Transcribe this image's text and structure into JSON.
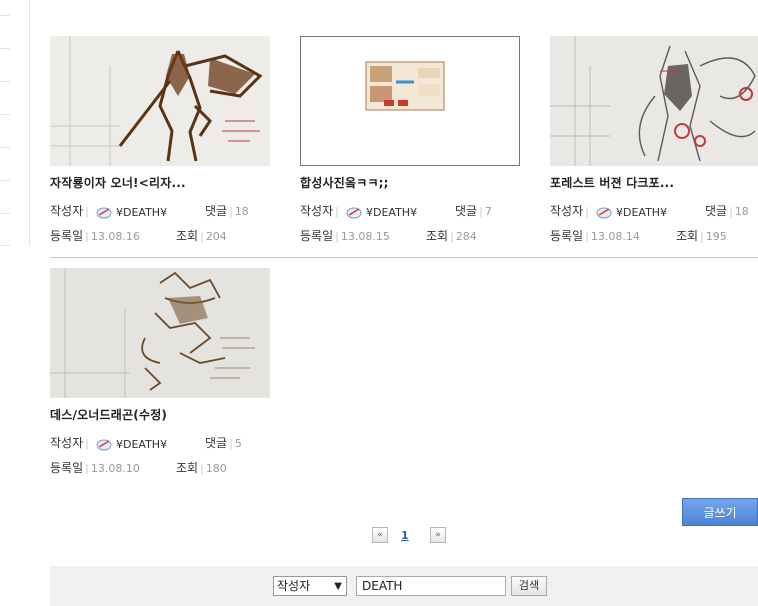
{
  "posts": [
    {
      "title": "자작룡이자 오너!<리자...",
      "author_label": "작성자",
      "author": "¥DEATH¥",
      "comments_label": "댓글",
      "comments": "18",
      "date_label": "등록일",
      "date": "13.08.16",
      "views_label": "조회",
      "views": "204"
    },
    {
      "title": "합성사진옼ㅋㅋ;;",
      "author_label": "작성자",
      "author": "¥DEATH¥",
      "comments_label": "댓글",
      "comments": "7",
      "date_label": "등록일",
      "date": "13.08.15",
      "views_label": "조회",
      "views": "284"
    },
    {
      "title": "포레스트 버젼 다크포...",
      "author_label": "작성자",
      "author": "¥DEATH¥",
      "comments_label": "댓글",
      "comments": "18",
      "date_label": "등록일",
      "date": "13.08.14",
      "views_label": "조회",
      "views": "195"
    },
    {
      "title": "데스/오너드래곤(수정)",
      "author_label": "작성자",
      "author": "¥DEATH¥",
      "comments_label": "댓글",
      "comments": "5",
      "date_label": "등록일",
      "date": "13.08.10",
      "views_label": "조회",
      "views": "180"
    }
  ],
  "write_button": "글쓰기",
  "pagination": {
    "prev_icon": "«",
    "current": "1",
    "next_icon": "»"
  },
  "search": {
    "field": "작성자",
    "query": "DEATH",
    "button": "검색"
  }
}
